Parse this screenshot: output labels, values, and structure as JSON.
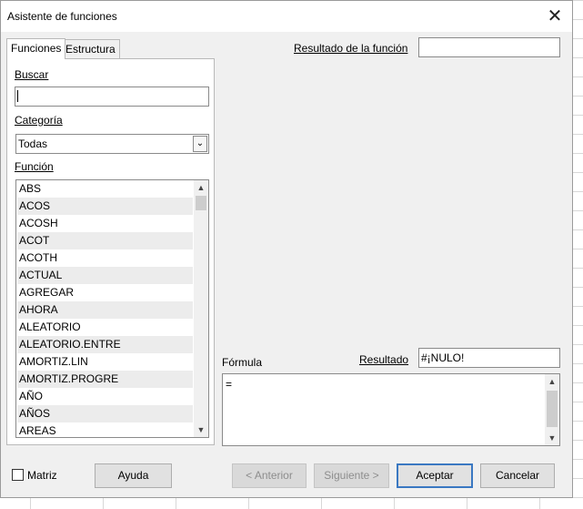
{
  "dialog": {
    "title": "Asistente de funciones",
    "close_glyph": "✕"
  },
  "tabs": [
    {
      "label": "Funciones",
      "active": true
    },
    {
      "label": "Estructura",
      "active": false
    }
  ],
  "search": {
    "label": "Buscar",
    "value": ""
  },
  "category": {
    "label": "Categoría",
    "value": "Todas"
  },
  "functions": {
    "label": "Función",
    "items": [
      "ABS",
      "ACOS",
      "ACOSH",
      "ACOT",
      "ACOTH",
      "ACTUAL",
      "AGREGAR",
      "AHORA",
      "ALEATORIO",
      "ALEATORIO.ENTRE",
      "AMORTIZ.LIN",
      "AMORTIZ.PROGRE",
      "AÑO",
      "AÑOS",
      "AREAS"
    ]
  },
  "function_result": {
    "label": "Resultado de la función",
    "value": ""
  },
  "formula": {
    "label": "Fórmula",
    "value": "="
  },
  "result": {
    "label": "Resultado",
    "value": "#¡NULO!"
  },
  "matriz": {
    "label": "Matriz",
    "checked": false
  },
  "buttons": {
    "help": "Ayuda",
    "back": "< Anterior",
    "next": "Siguiente >",
    "ok": "Aceptar",
    "cancel": "Cancelar"
  }
}
